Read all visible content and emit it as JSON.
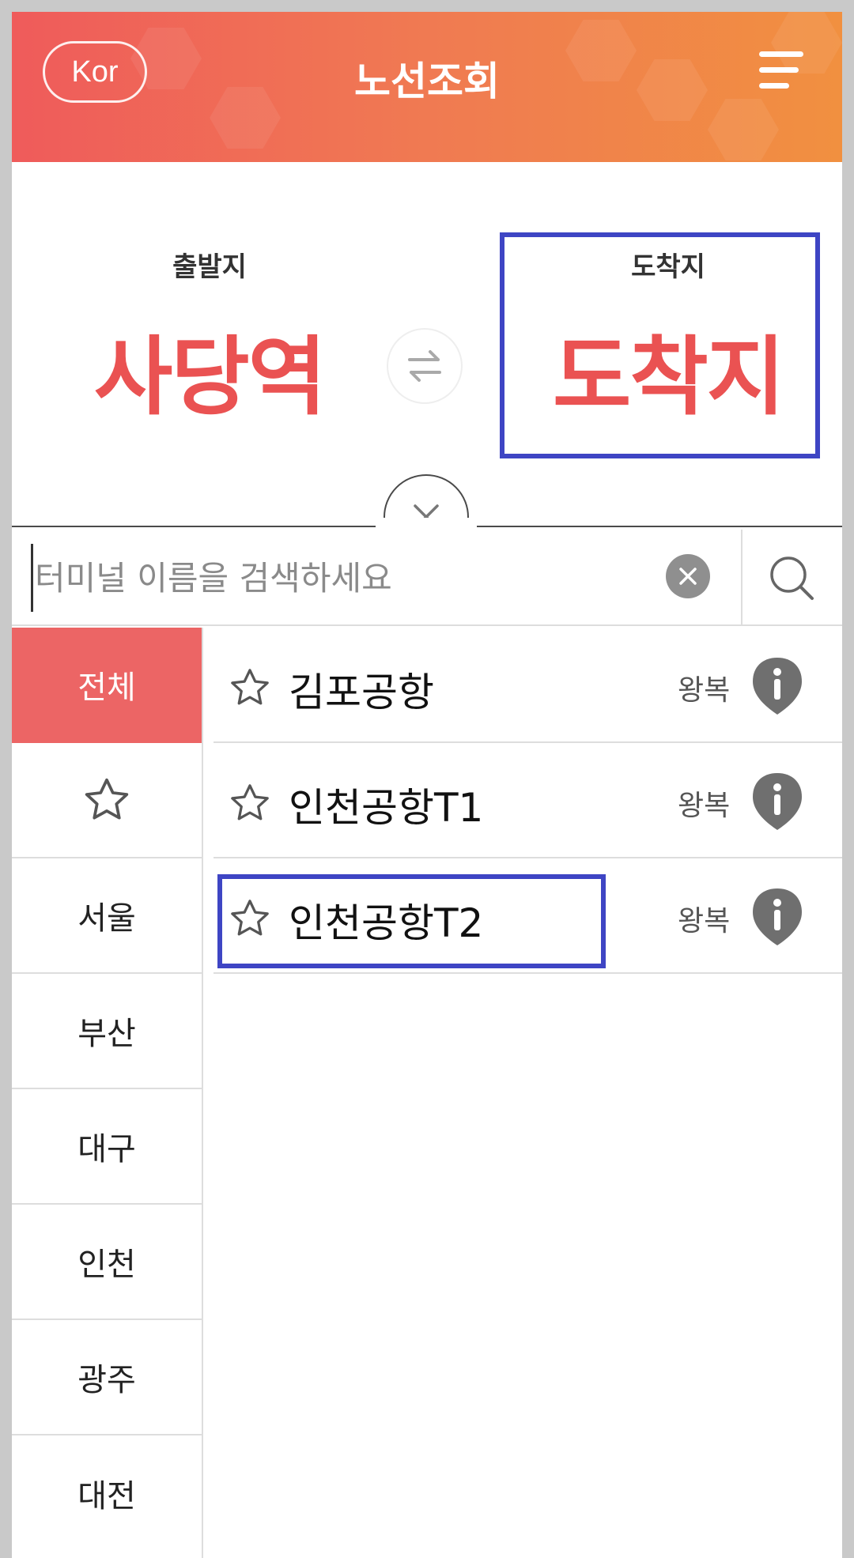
{
  "header": {
    "language_label": "Kor",
    "title": "노선조회"
  },
  "route": {
    "departure_label": "출발지",
    "departure_value": "사당역",
    "arrival_label": "도착지",
    "arrival_value": "도착지",
    "swap_icon": "⇄",
    "close_icon": "✕"
  },
  "search": {
    "placeholder": "터미널 이름을 검색하세요",
    "value": "",
    "clear_icon": "✕"
  },
  "sidebar": {
    "items": [
      {
        "label": "전체",
        "active": true
      },
      {
        "label": "",
        "icon": "star-outline-icon"
      },
      {
        "label": "서울"
      },
      {
        "label": "부산"
      },
      {
        "label": "대구"
      },
      {
        "label": "인천"
      },
      {
        "label": "광주"
      },
      {
        "label": "대전"
      }
    ]
  },
  "terminals": [
    {
      "name": "김포공항",
      "trip_type": "왕복"
    },
    {
      "name": "인천공항T1",
      "trip_type": "왕복"
    },
    {
      "name": "인천공항T2",
      "trip_type": "왕복"
    }
  ],
  "colors": {
    "accent": "#ea5252",
    "highlight_box": "#3e45c4",
    "header_start": "#ef5b5b",
    "header_end": "#f19040"
  }
}
